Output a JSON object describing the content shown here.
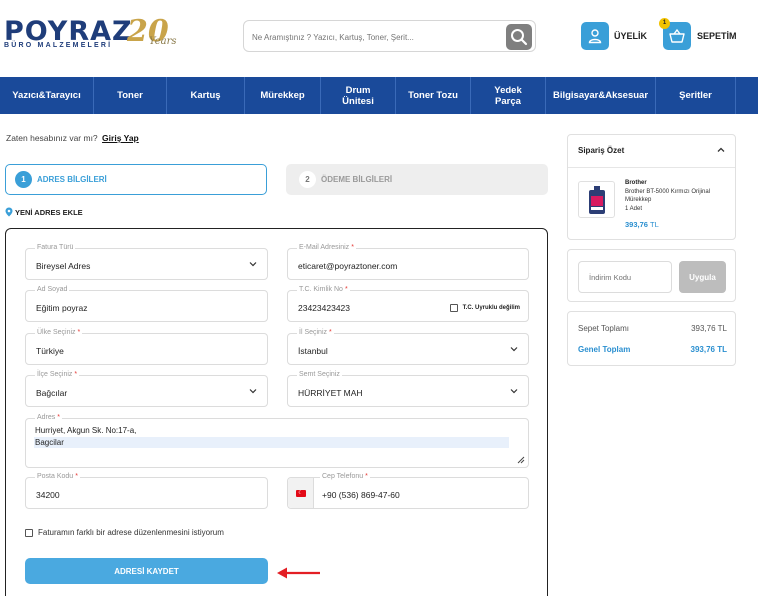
{
  "header": {
    "brand": "POYRAZ",
    "brand_sub": "BÜRO MALZEMELERİ",
    "anniversary": "20",
    "anniversary_sub": "Years",
    "search_placeholder": "Ne Aramıştınız ? Yazıcı, Kartuş, Toner, Şerit...",
    "account_label": "ÜYELİK",
    "cart_label": "SEPETİM",
    "cart_count": "1"
  },
  "nav": {
    "items": [
      {
        "label": "Yazıcı&Tarayıcı"
      },
      {
        "label": "Toner"
      },
      {
        "label": "Kartuş"
      },
      {
        "label": "Mürekkep"
      },
      {
        "label": "Drum Ünitesi"
      },
      {
        "label": "Toner Tozu"
      },
      {
        "label": "Yedek Parça"
      },
      {
        "label": "Bilgisayar&Aksesuar"
      },
      {
        "label": "Şeritler"
      }
    ]
  },
  "checkout": {
    "already_text": "Zaten hesabınız var mı?",
    "login_link": "Giriş Yap",
    "steps": [
      {
        "num": "1",
        "label": "ADRES BİLGİLERİ"
      },
      {
        "num": "2",
        "label": "ÖDEME BİLGİLERİ"
      }
    ],
    "new_address": "YENİ ADRES EKLE"
  },
  "form": {
    "fatura_turu": {
      "label": "Fatura Türü",
      "value": "Bireysel Adres"
    },
    "email": {
      "label": "E-Mail Adresiniz",
      "value": "eticaret@poyraztoner.com"
    },
    "ad_soyad": {
      "label": "Ad Soyad",
      "value": "Eğitim poyraz"
    },
    "tc": {
      "label": "T.C. Kimlik No",
      "value": "23423423423",
      "check_label": "T.C. Uyruklu değilim"
    },
    "ulke": {
      "label": "Ülke Seçiniz",
      "value": "Türkiye"
    },
    "il": {
      "label": "İl Seçiniz",
      "value": "İstanbul"
    },
    "ilce": {
      "label": "İlçe Seçiniz",
      "value": "Bağcılar"
    },
    "semt": {
      "label": "Semt Seçiniz",
      "value": "HÜRRİYET MAH"
    },
    "adres": {
      "label": "Adres",
      "line1": "Hurriyet, Akgun Sk. No:17-a,",
      "line2": "Bagcilar"
    },
    "posta": {
      "label": "Posta Kodu",
      "value": "34200"
    },
    "telefon": {
      "label": "Cep Telefonu",
      "value": "+90 (536) 869-47-60"
    },
    "diff_address": "Faturamın farklı bir adrese düzenlenmesini istiyorum",
    "save_button": "ADRESİ KAYDET"
  },
  "summary": {
    "title": "Sipariş Özet",
    "product": {
      "brand": "Brother",
      "name": "Brother BT-5000 Kırmızı Orijinal Mürekkep",
      "qty": "1 Adet",
      "price": "393,76",
      "currency": "TL"
    }
  },
  "coupon": {
    "placeholder": "İndirim Kodu",
    "button": "Uygula"
  },
  "totals": {
    "subtotal_label": "Sepet Toplamı",
    "subtotal_value": "393,76 TL",
    "total_label": "Genel Toplam",
    "total_value": "393,76 TL"
  },
  "colors": {
    "nav_bg": "#1a4a9a",
    "accent": "#3a9fd8",
    "required": "#e53935",
    "arrow": "#e31e24"
  }
}
